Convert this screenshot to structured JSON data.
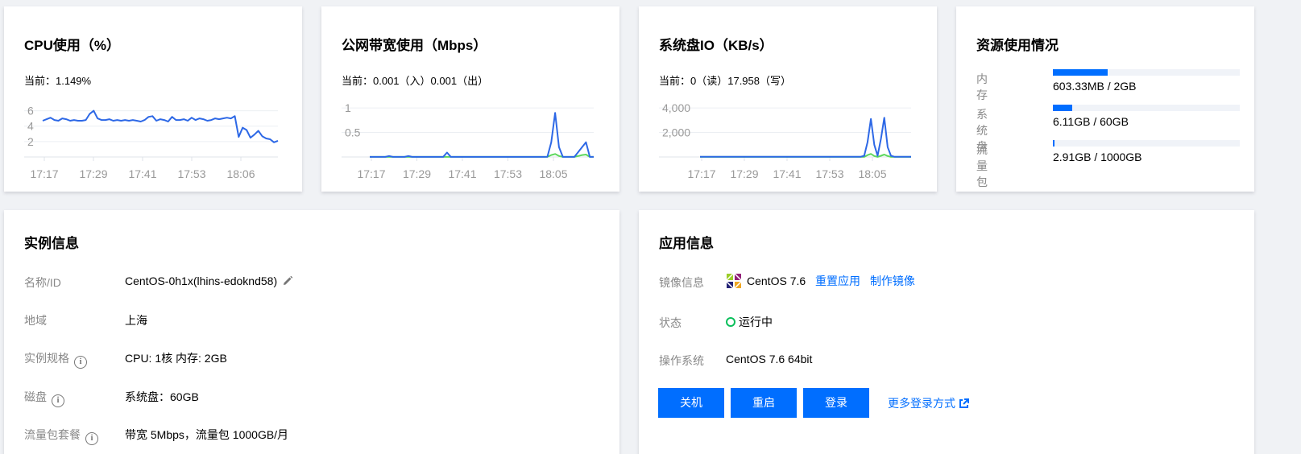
{
  "cpu": {
    "title": "CPU使用（%）",
    "current": "当前：1.149%",
    "chart_data": {
      "type": "line",
      "x_ticks": [
        "17:17",
        "17:29",
        "17:41",
        "17:53",
        "18:06"
      ],
      "y_ticks": [
        "6",
        "4",
        "2"
      ],
      "series": [
        {
          "color": "#2d68e6",
          "values": [
            4.7,
            4.9,
            5.1,
            4.8,
            4.7,
            5.0,
            4.9,
            4.7,
            4.8,
            4.7,
            4.7,
            4.8,
            5.6,
            6.0,
            5.0,
            4.8,
            4.8,
            4.9,
            4.7,
            4.8,
            4.7,
            4.8,
            4.7,
            4.8,
            4.7,
            4.6,
            4.8,
            5.2,
            5.3,
            4.7,
            4.9,
            4.8,
            4.6,
            5.2,
            4.8,
            4.8,
            4.9,
            4.7,
            5.1,
            4.8,
            5.0,
            4.9,
            4.7,
            4.8,
            5.0,
            4.9,
            5.0,
            5.1,
            5.0,
            5.3,
            2.6,
            3.8,
            3.5,
            2.5,
            2.9,
            3.4,
            2.7,
            2.4,
            2.3,
            1.9,
            2.1
          ]
        }
      ],
      "ylim": [
        0,
        7
      ]
    }
  },
  "bandwidth": {
    "title": "公网带宽使用（Mbps）",
    "current": "当前：0.001（入）0.001（出）",
    "chart_data": {
      "type": "line",
      "x_ticks": [
        "17:17",
        "17:29",
        "17:41",
        "17:53",
        "18:05"
      ],
      "y_ticks": [
        "1",
        "0.5"
      ],
      "ylim": [
        0,
        1.1
      ],
      "series": [
        {
          "color": "#2d68e6",
          "values": [
            0.002,
            0.002,
            0.002,
            0.002,
            0.002,
            0.02,
            0.002,
            0.002,
            0.002,
            0.002,
            0.02,
            0.002,
            0.002,
            0.002,
            0.002,
            0.002,
            0.002,
            0.002,
            0.002,
            0.002,
            0.09,
            0.002,
            0.002,
            0.002,
            0.002,
            0.002,
            0.002,
            0.002,
            0.002,
            0.002,
            0.002,
            0.002,
            0.002,
            0.002,
            0.002,
            0.002,
            0.002,
            0.002,
            0.002,
            0.002,
            0.002,
            0.002,
            0.002,
            0.002,
            0.002,
            0.002,
            0.005,
            0.3,
            0.9,
            0.2,
            0.002,
            0.002,
            0.002,
            0.002,
            0.1,
            0.2,
            0.3,
            0.002,
            0.002
          ]
        },
        {
          "color": "#5ed85e",
          "values": [
            0.001,
            0.001,
            0.001,
            0.001,
            0.001,
            0.001,
            0.001,
            0.001,
            0.001,
            0.001,
            0.001,
            0.001,
            0.001,
            0.001,
            0.001,
            0.001,
            0.001,
            0.001,
            0.001,
            0.001,
            0.001,
            0.001,
            0.001,
            0.001,
            0.001,
            0.001,
            0.001,
            0.001,
            0.001,
            0.001,
            0.001,
            0.001,
            0.001,
            0.001,
            0.001,
            0.001,
            0.001,
            0.001,
            0.001,
            0.001,
            0.001,
            0.001,
            0.001,
            0.001,
            0.001,
            0.001,
            0.001,
            0.04,
            0.06,
            0.02,
            0.001,
            0.001,
            0.001,
            0.001,
            0.02,
            0.04,
            0.05,
            0.001,
            0.001
          ]
        }
      ]
    }
  },
  "disk": {
    "title": "系统盘IO（KB/s）",
    "current": "当前：0（读）17.958（写）",
    "chart_data": {
      "type": "line",
      "x_ticks": [
        "17:17",
        "17:29",
        "17:41",
        "17:53",
        "18:05"
      ],
      "y_ticks": [
        "4,000",
        "2,000"
      ],
      "ylim": [
        0,
        4400
      ],
      "series": [
        {
          "color": "#2d68e6",
          "values": [
            20,
            20,
            20,
            20,
            20,
            20,
            20,
            20,
            20,
            20,
            20,
            20,
            20,
            20,
            20,
            20,
            20,
            20,
            20,
            20,
            20,
            20,
            20,
            20,
            20,
            20,
            20,
            20,
            20,
            20,
            20,
            20,
            20,
            20,
            20,
            20,
            20,
            20,
            20,
            20,
            20,
            20,
            20,
            20,
            20,
            20,
            20,
            20,
            20,
            100,
            1200,
            3100,
            1000,
            100,
            1500,
            3200,
            800,
            100,
            20,
            20,
            20,
            20,
            20,
            20
          ]
        },
        {
          "color": "#5ed85e",
          "values": [
            5,
            5,
            5,
            5,
            5,
            5,
            5,
            5,
            5,
            5,
            5,
            5,
            5,
            5,
            5,
            5,
            5,
            5,
            5,
            5,
            5,
            5,
            5,
            5,
            5,
            5,
            5,
            5,
            5,
            5,
            5,
            5,
            5,
            5,
            5,
            5,
            5,
            5,
            5,
            5,
            5,
            5,
            5,
            5,
            5,
            5,
            5,
            5,
            5,
            5,
            150,
            250,
            80,
            5,
            100,
            200,
            80,
            5,
            5,
            5,
            5,
            5,
            5,
            5
          ]
        }
      ]
    }
  },
  "resources": {
    "title": "资源使用情况",
    "items": [
      {
        "label": "内存",
        "value": "603.33MB / 2GB",
        "fraction": 0.295
      },
      {
        "label": "系统盘",
        "value": "6.11GB / 60GB",
        "fraction": 0.102
      },
      {
        "label": "流量包",
        "value": "2.91GB / 1000GB",
        "fraction": 0.003
      }
    ]
  },
  "instance": {
    "title": "实例信息",
    "rows": [
      {
        "label": "名称/ID",
        "value": "CentOS-0h1x(lhins-edoknd58)"
      },
      {
        "label": "地域",
        "value": "上海"
      },
      {
        "label": "实例规格",
        "value": "CPU: 1核 内存: 2GB"
      },
      {
        "label": "磁盘",
        "value": "系统盘：60GB"
      },
      {
        "label": "流量包套餐",
        "value": "带宽 5Mbps，流量包 1000GB/月"
      }
    ]
  },
  "app": {
    "title": "应用信息",
    "image_label": "镜像信息",
    "image_value": "CentOS 7.6",
    "reset_link": "重置应用",
    "make_image_link": "制作镜像",
    "status_label": "状态",
    "status_value": "运行中",
    "os_label": "操作系统",
    "os_value": "CentOS 7.6 64bit",
    "buttons": {
      "shutdown": "关机",
      "restart": "重启",
      "login": "登录"
    },
    "more_login": "更多登录方式"
  },
  "colors": {
    "accent": "#006eff",
    "line": "#2d68e6",
    "line_secondary": "#5ed85e",
    "status_ok": "#0abf5b"
  }
}
